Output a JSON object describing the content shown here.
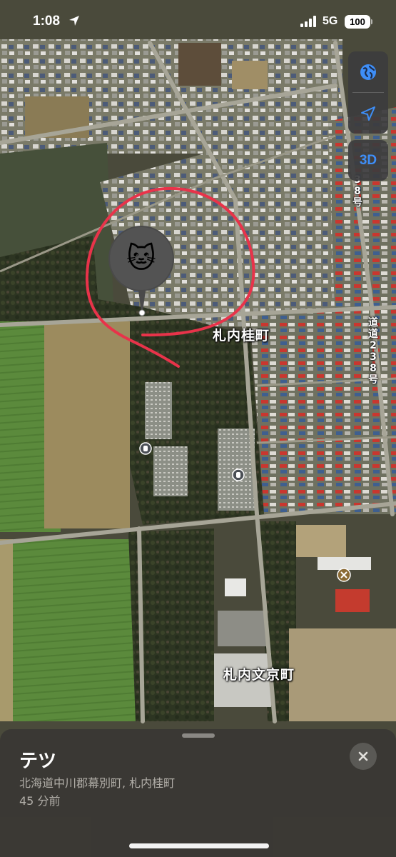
{
  "status_bar": {
    "time": "1:08",
    "network": "5G",
    "battery": "100"
  },
  "map": {
    "controls": {
      "globe_icon": "globe-icon",
      "location_icon": "location-arrow-icon",
      "three_d_label": "3D"
    },
    "labels": {
      "area_1": "札内桂町",
      "area_2": "札内文京町",
      "route_1": "道道238号",
      "route_2": "38号"
    },
    "pin_emoji": "🐱",
    "annotation_color": "#e8334a"
  },
  "sheet": {
    "title": "テツ",
    "address": "北海道中川郡幕別町, 札内桂町",
    "ago": "45 分前"
  },
  "colors": {
    "accent": "#3e8ef7",
    "sheet_bg": "#3a3834"
  }
}
